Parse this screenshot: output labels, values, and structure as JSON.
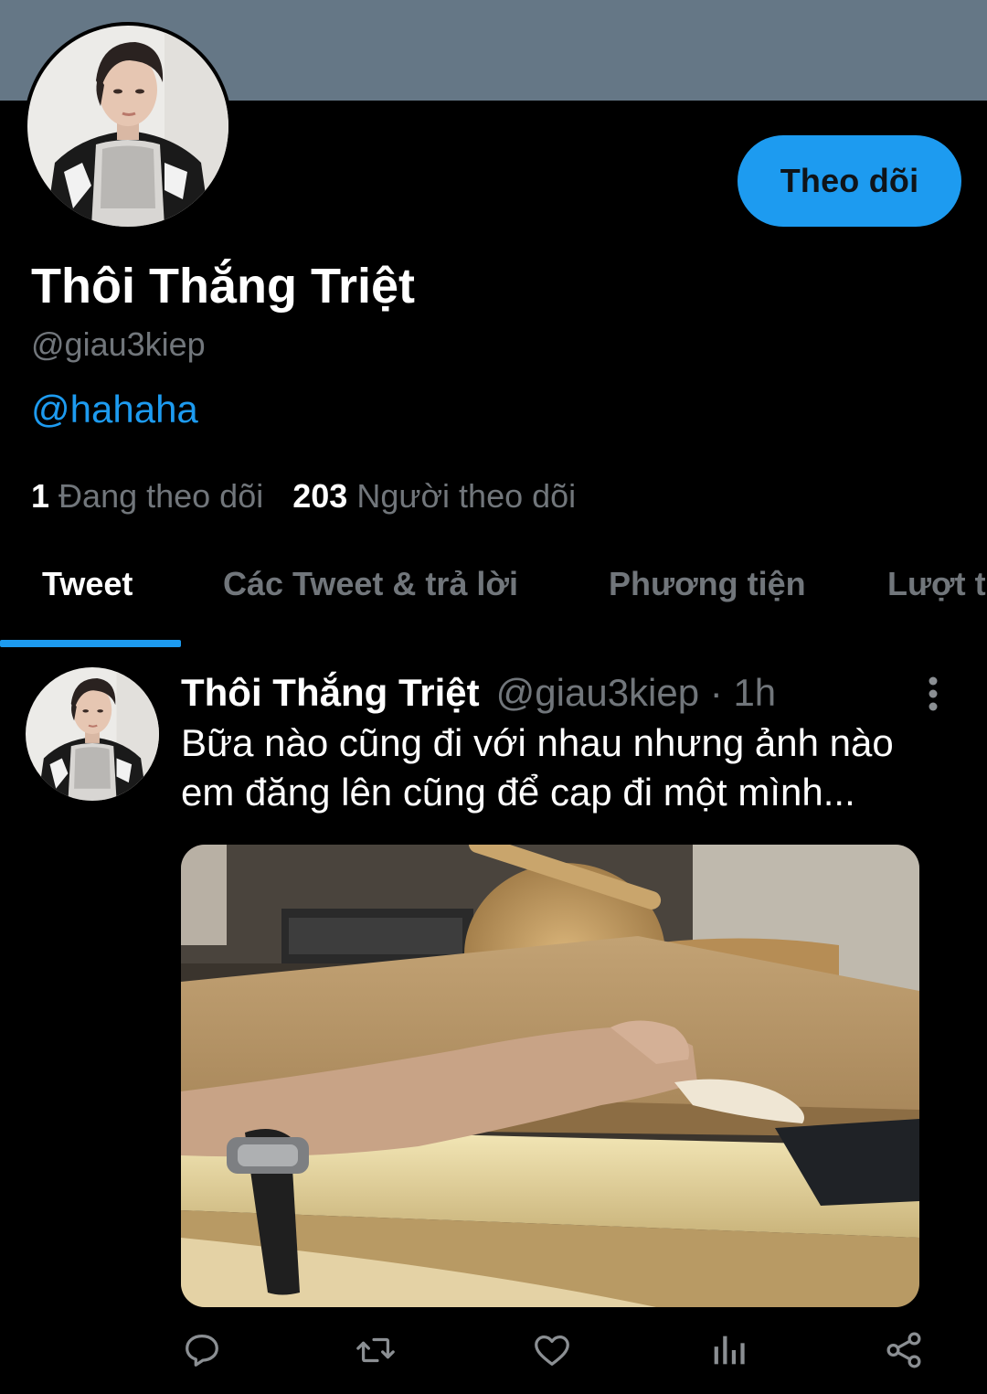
{
  "profile": {
    "display_name": "Thôi Thắng Triệt",
    "handle": "@giau3kiep",
    "bio": "@hahaha",
    "follow_label": "Theo dõi",
    "following_count": "1",
    "following_label": "Đang theo dõi",
    "followers_count": "203",
    "followers_label": "Người theo dõi"
  },
  "tabs": [
    {
      "label": "Tweet",
      "active": true
    },
    {
      "label": "Các Tweet & trả lời",
      "active": false
    },
    {
      "label": "Phương tiện",
      "active": false
    },
    {
      "label": "Lượt thích",
      "active": false
    }
  ],
  "tweet": {
    "author_name": "Thôi Thắng Triệt",
    "author_handle": "@giau3kiep",
    "time": "1h",
    "separator": "·",
    "text": "Bữa nào cũng đi với nhau nhưng ảnh nào em đăng lên cũng để cap đi một mình...",
    "actions": [
      "reply-icon",
      "retweet-icon",
      "like-icon",
      "analytics-icon",
      "share-icon"
    ]
  },
  "colors": {
    "banner": "#657786",
    "accent": "#1d9bf0",
    "background": "#000000",
    "secondary_text": "#71767b"
  }
}
